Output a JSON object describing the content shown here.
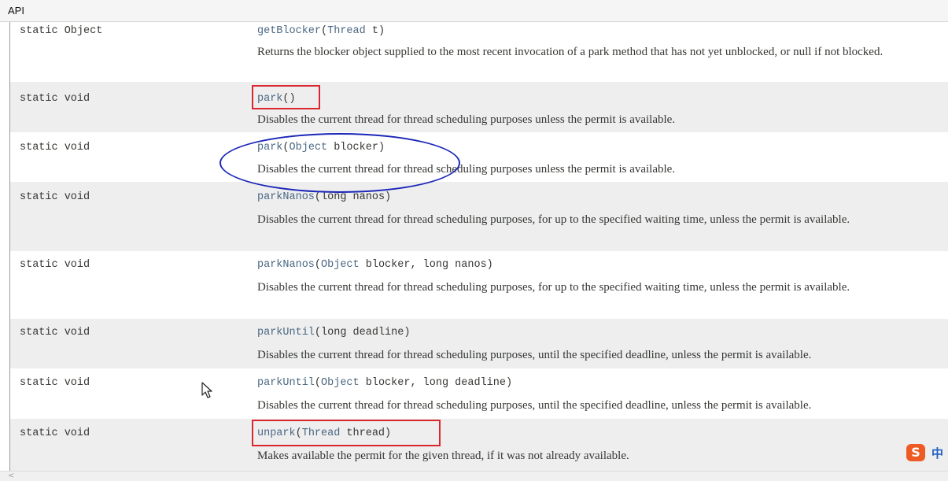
{
  "window": {
    "title": "API"
  },
  "methods": [
    {
      "modifier": "static Object",
      "name": "getBlocker",
      "params": [
        {
          "type": "Thread",
          "name": " t"
        }
      ],
      "description": "Returns the blocker object supplied to the most recent invocation of a park method that has not yet unblocked, or null if not blocked."
    },
    {
      "modifier": "static void",
      "name": "park",
      "params": [],
      "description": "Disables the current thread for thread scheduling purposes unless the permit is available."
    },
    {
      "modifier": "static void",
      "name": "park",
      "params": [
        {
          "type": "Object",
          "name": " blocker"
        }
      ],
      "description": "Disables the current thread for thread scheduling purposes unless the permit is available."
    },
    {
      "modifier": "static void",
      "name": "parkNanos",
      "params": [
        {
          "type": "",
          "name": "long nanos"
        }
      ],
      "description": "Disables the current thread for thread scheduling purposes, for up to the specified waiting time, unless the permit is available."
    },
    {
      "modifier": "static void",
      "name": "parkNanos",
      "params": [
        {
          "type": "Object",
          "name": " blocker"
        },
        {
          "type": "",
          "name": "long nanos"
        }
      ],
      "description": "Disables the current thread for thread scheduling purposes, for up to the specified waiting time, unless the permit is available."
    },
    {
      "modifier": "static void",
      "name": "parkUntil",
      "params": [
        {
          "type": "",
          "name": "long deadline"
        }
      ],
      "description": "Disables the current thread for thread scheduling purposes, until the specified deadline, unless the permit is available."
    },
    {
      "modifier": "static void",
      "name": "parkUntil",
      "params": [
        {
          "type": "Object",
          "name": " blocker"
        },
        {
          "type": "",
          "name": "long deadline"
        }
      ],
      "description": "Disables the current thread for thread scheduling purposes, until the specified deadline, unless the permit is available."
    },
    {
      "modifier": "static void",
      "name": "unpark",
      "params": [
        {
          "type": "Thread",
          "name": " thread"
        }
      ],
      "description": "Makes available the permit for the given thread, if it was not already available."
    }
  ],
  "ime": {
    "logo": "S",
    "lang": "中"
  },
  "colors": {
    "highlight_box": "#d9272e",
    "highlight_ellipse": "#1b27b8",
    "link": "#4a6782",
    "row_alt": "#eeeeef"
  },
  "icons": {
    "cursor": "arrow-cursor-icon",
    "scroll_left": "scroll-left-arrow-icon"
  }
}
